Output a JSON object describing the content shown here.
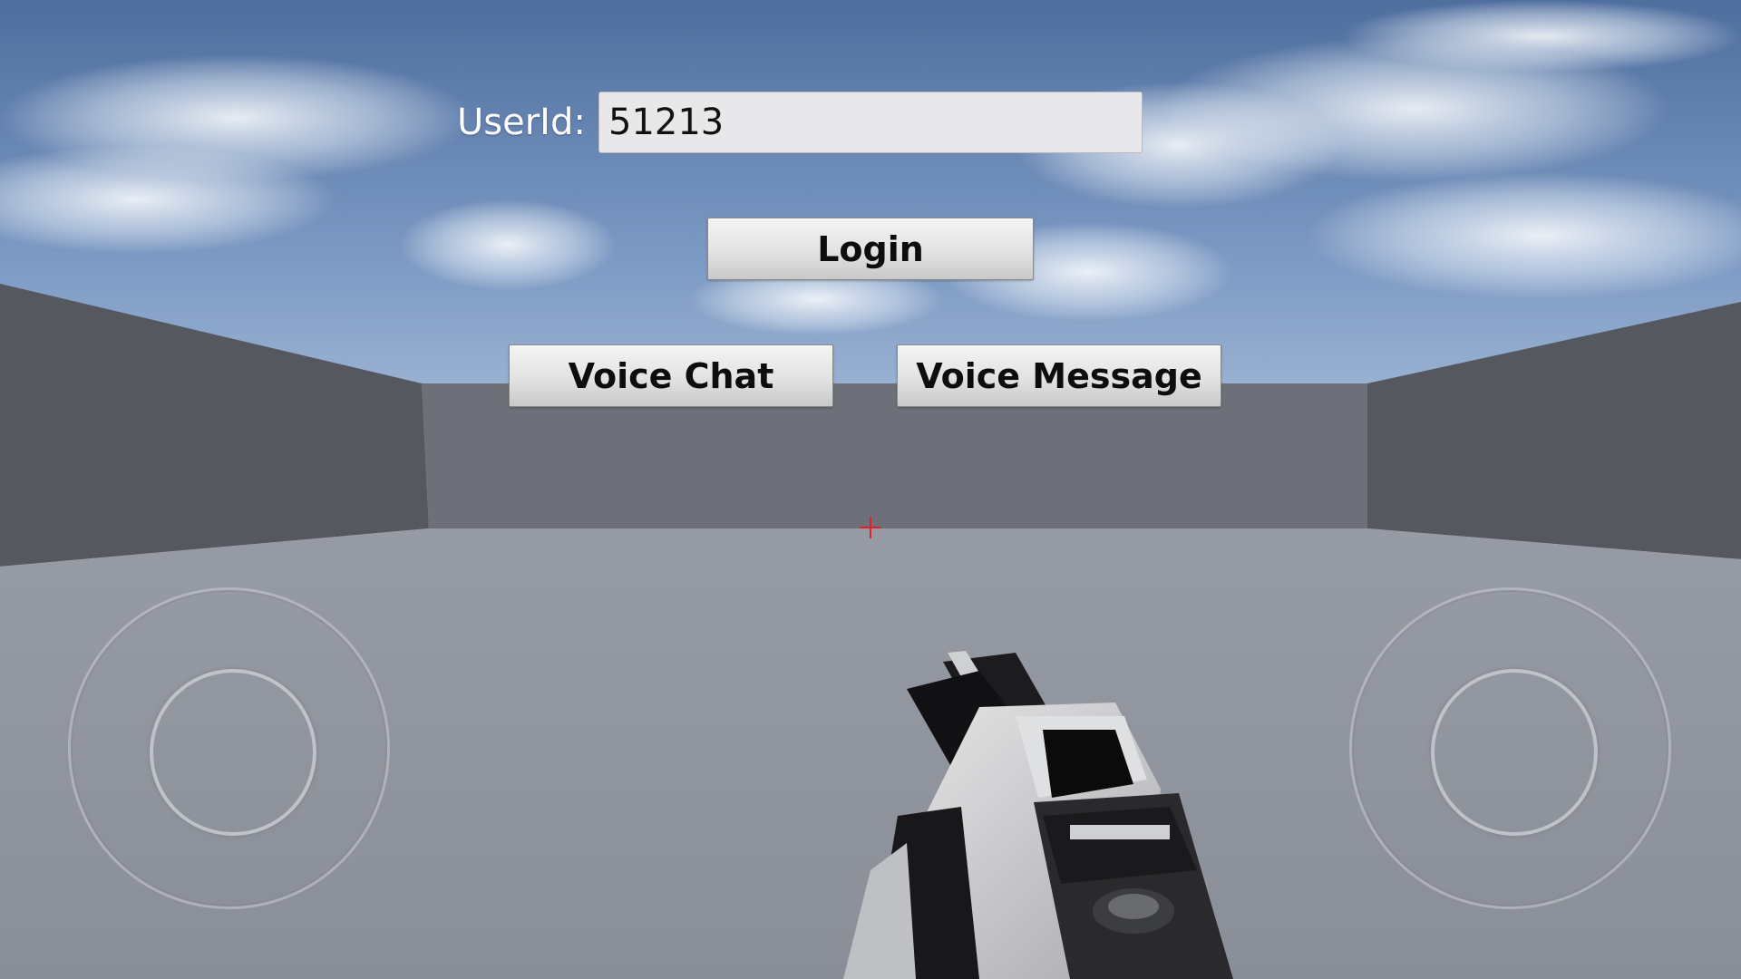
{
  "login_panel": {
    "userid_label": "UserId:",
    "userid_value": "51213"
  },
  "buttons": {
    "login_label": "Login",
    "voice_chat_label": "Voice Chat",
    "voice_message_label": "Voice Message"
  },
  "colors": {
    "crosshair": "#e0202a",
    "button_text": "#0d0d0d",
    "label_text": "#ffffff"
  },
  "icons": {
    "crosshair": "crosshair-icon",
    "left_joystick": "move-joystick",
    "right_joystick": "look-joystick"
  }
}
